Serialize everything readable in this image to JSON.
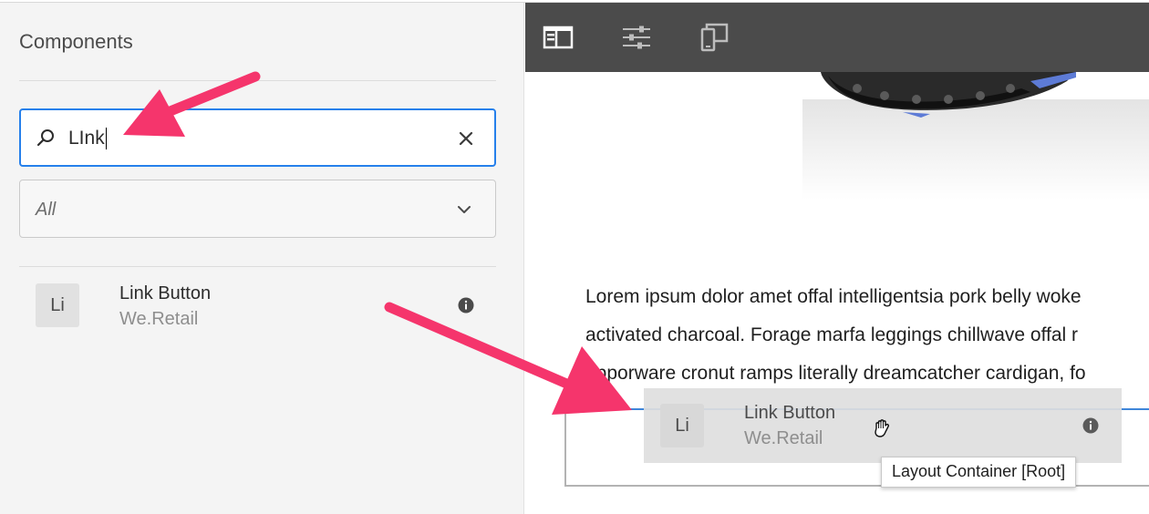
{
  "panel": {
    "title": "Components",
    "search": {
      "value": "LInk",
      "icon": "search-icon",
      "clear_icon": "close-icon"
    },
    "filter": {
      "selected": "All",
      "icon": "chevron-down-icon"
    },
    "results": [
      {
        "avatar": "Li",
        "title": "Link Button",
        "group": "We.Retail",
        "icon": "info-icon"
      }
    ]
  },
  "toolbar": {
    "buttons": [
      {
        "icon": "side-panel-icon"
      },
      {
        "icon": "properties-sliders-icon"
      },
      {
        "icon": "emulator-device-icon"
      }
    ]
  },
  "page": {
    "paragraph_lines": [
      "Lorem ipsum dolor amet offal intelligentsia pork belly woke",
      "activated charcoal. Forage marfa leggings chillwave offal r",
      "apporware cronut ramps literally dreamcatcher cardigan, fo"
    ],
    "drag_ghost": {
      "avatar": "Li",
      "title": "Link Button",
      "group": "We.Retail"
    },
    "tooltip": "Layout Container [Root]"
  },
  "colors": {
    "annotation_arrow": "#f5356c",
    "focus": "#2680eb",
    "toolbar": "#4b4b4b"
  }
}
